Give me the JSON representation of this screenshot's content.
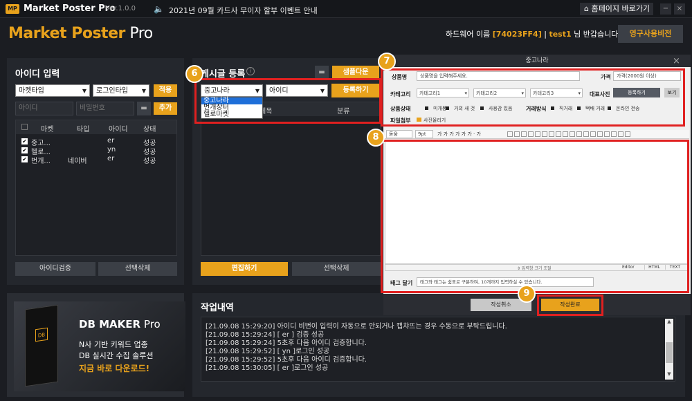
{
  "titlebar": {
    "logo": "MP",
    "app_title": "Market Poster Pro",
    "version": "Ver.1.0.0",
    "notice": "2021년 09월 카드사 무이자 할부 이벤트 안내",
    "home_button": "홈페이지 바로가기",
    "min": "−",
    "close": "×",
    "speaker_icon": "speaker-icon"
  },
  "header": {
    "brand_main": "Market Poster",
    "brand_pro": " Pro",
    "hw_label": "하드웨어 이름",
    "hw_id": "[74023FF4]",
    "user": "test1",
    "greet": "님 반갑습니다!",
    "perm_button": "영구사용비전"
  },
  "id_panel": {
    "title": "아이디 입력",
    "market_select": "마켓타입",
    "login_select": "로그인타입",
    "apply": "적용",
    "id_placeholder": "아이디",
    "pw_placeholder": "비밀번호",
    "add": "추가",
    "columns": [
      "마켓",
      "타입",
      "아이디",
      "상태"
    ],
    "rows": [
      {
        "market": "중고...",
        "type": "",
        "id": "er",
        "status": "성공"
      },
      {
        "market": "헬로...",
        "type": "",
        "id": "yn",
        "status": "성공"
      },
      {
        "market": "번개...",
        "type": "네이버",
        "id": "er",
        "status": "성공"
      }
    ],
    "verify": "아이디검증",
    "delete": "선택삭제"
  },
  "post_panel": {
    "title": "게시글 등록",
    "folder_icon": "folder-icon",
    "sample_download": "샘플다운",
    "market_select": "중고나라",
    "id_select": "아이디",
    "register": "등록하기",
    "dropdown_options": [
      "중고나라",
      "번개장터",
      "헬로마켓"
    ],
    "col_title": "제목",
    "col_category": "분류",
    "edit": "편집하기",
    "delete": "선택삭제"
  },
  "steps": [
    "6",
    "7",
    "8",
    "9"
  ],
  "ad": {
    "brand": "DB MAKER",
    "brand_pro": " Pro",
    "line1": "N사 기반 키워드 업종",
    "line2": "DB 실시간 수집 솔루션",
    "line3": "지금 바로 다운로드!",
    "box_label": "DB"
  },
  "log": {
    "title": "작업내역",
    "lines": [
      "[21.09.08 15:29:20]  아이디 비번이 입력이 자동으로 안되거나 캡챠뜨는 경우 수동으로 부탁드립니다.",
      "[21.09.08 15:29:24]  [ er          ] 검증 성공",
      "[21.09.08 15:29:24]  5초후 다음 아이디 검증합니다.",
      "[21.09.08 15:29:52]  [ yn                         ]로그인 성공",
      "[21.09.08 15:29:52]  5초후 다음 아이디 검증합니다.",
      "[21.09.08 15:30:05]  [ er          ]로그인 성공"
    ]
  },
  "dialog": {
    "title": "중고나라",
    "close": "×",
    "product_label": "상품명",
    "product_placeholder": "상품명을 입력해주세요.",
    "price_label": "가격",
    "price_placeholder": "가격(2000원 이상)",
    "category_label": "카테고리",
    "cat1": "카테고리1",
    "cat2": "카테고리2",
    "cat3": "카테고리3",
    "rep_photo_label": "대표사진",
    "register_photo": "등록하기",
    "view": "보기",
    "condition_label": "상품상태",
    "conditions": [
      "미개봉",
      "거의 새 것",
      "사용감 있음"
    ],
    "trade_label": "거래방식",
    "trades": [
      "직거래",
      "택배 거래",
      "온라인 전송"
    ],
    "attach_label": "파일첨부",
    "photo_upload": "사진올리기",
    "toolbar_font": "돋움",
    "toolbar_size": "9pt",
    "toolbar_glyphs": "가 가 가 가 가  가 · 가",
    "resize": "⇕ 입력창 크기 조절",
    "tabs": [
      "Editor",
      "HTML",
      "TEXT"
    ],
    "tag_label": "태그 달기",
    "tag_placeholder": "태그와 태그는 쉼표로 구분하며, 10개까지 입력하실 수 있습니다.",
    "cancel": "작성취소",
    "done": "작성완료"
  }
}
